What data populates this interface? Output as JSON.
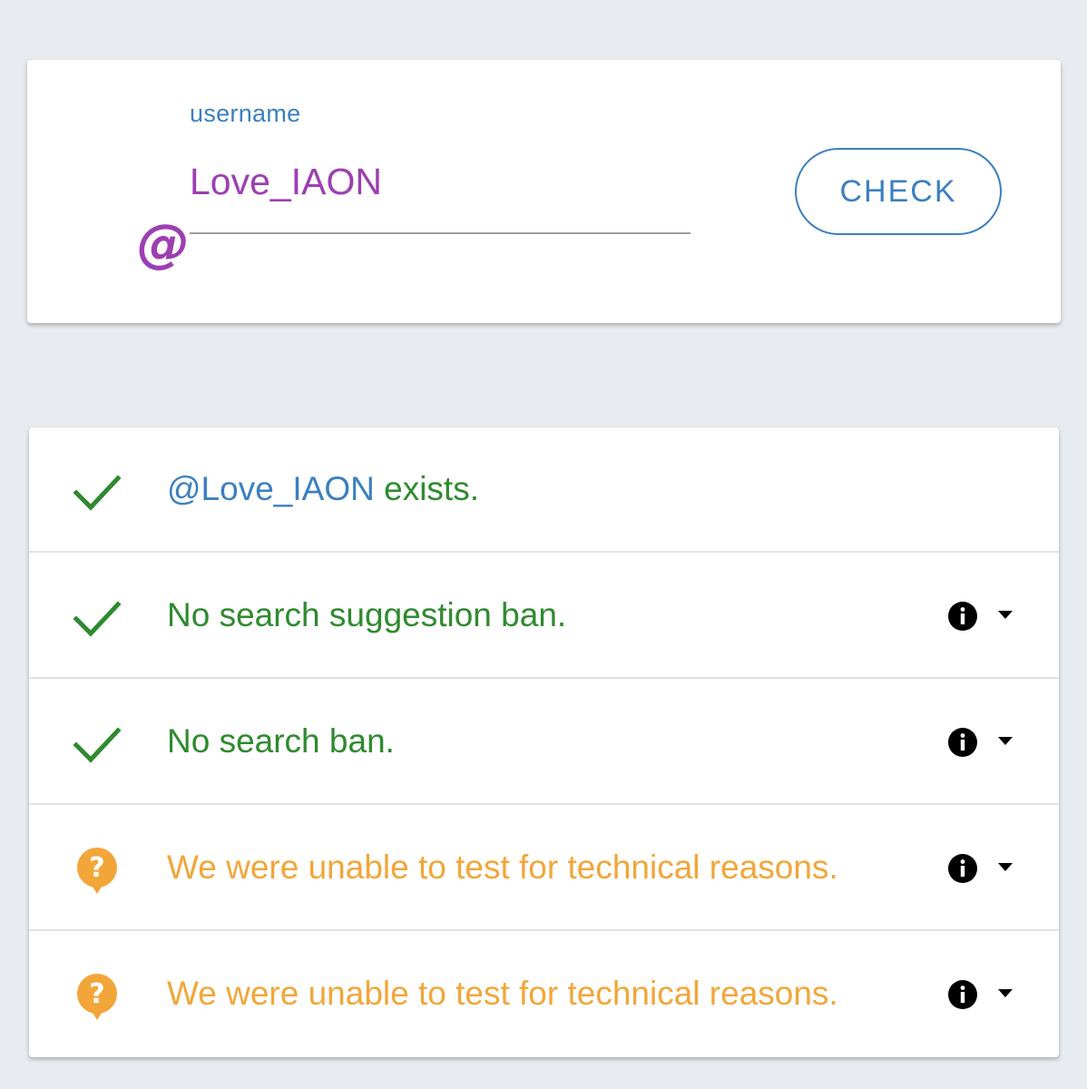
{
  "search": {
    "label": "username",
    "value": "Love_IAON",
    "prefix_icon": "at-sign-icon",
    "button_label": "CHECK"
  },
  "results": [
    {
      "status": "ok",
      "icon": "checkmark-icon",
      "handle": "@Love_IAON",
      "text": " exists.",
      "has_info": false
    },
    {
      "status": "ok",
      "icon": "checkmark-icon",
      "text": "No search suggestion ban.",
      "has_info": true
    },
    {
      "status": "ok",
      "icon": "checkmark-icon",
      "text": "No search ban.",
      "has_info": true
    },
    {
      "status": "warn",
      "icon": "question-bubble-icon",
      "text": "We were unable to test for technical reasons.",
      "has_info": true
    },
    {
      "status": "warn",
      "icon": "question-bubble-icon",
      "text": "We were unable to test for technical reasons.",
      "has_info": true
    }
  ],
  "colors": {
    "background": "#e8ebef",
    "accent_blue": "#3c7fc0",
    "input_purple": "#9c3fb2",
    "ok_green": "#2f8a2f",
    "warn_orange": "#f2a63a"
  }
}
